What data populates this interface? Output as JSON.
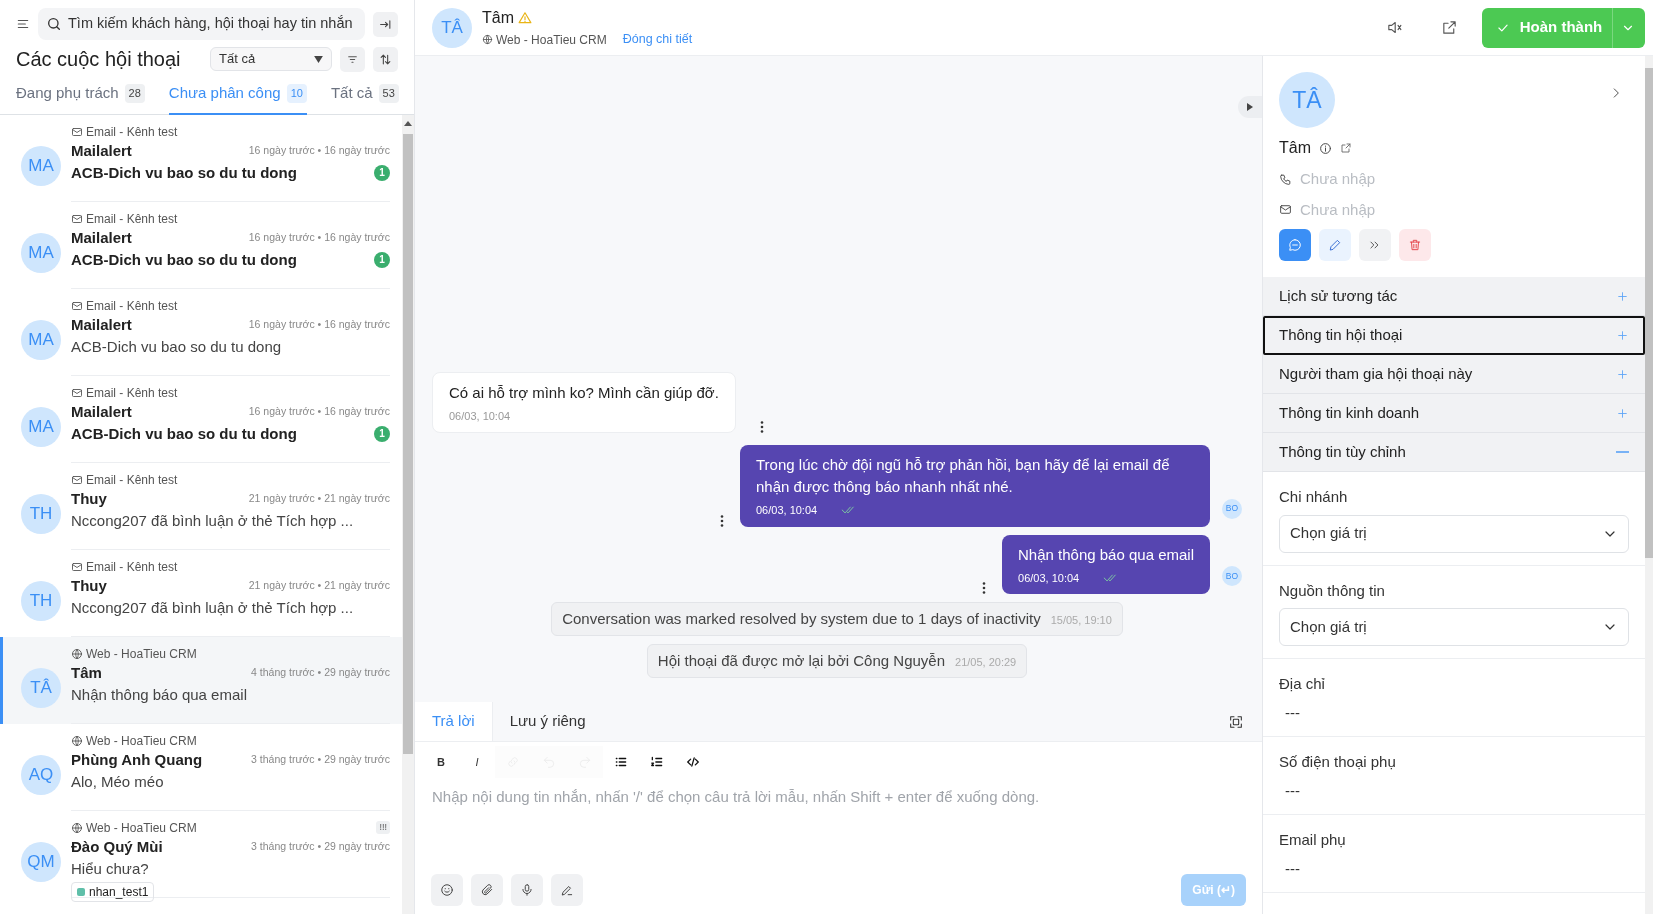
{
  "sidebar": {
    "search": {
      "placeholder": "Tìm kiếm khách hàng, hội thoại hay tin nhắn"
    },
    "title": "Các cuộc hội thoại",
    "filter": {
      "value": "Tất cả"
    },
    "tabs": [
      {
        "label": "Đang phụ trách",
        "count": "28",
        "selected": false
      },
      {
        "label": "Chưa phân công",
        "count": "10",
        "selected": true
      },
      {
        "label": "Tất cả",
        "count": "53",
        "selected": false
      }
    ],
    "conversations": [
      {
        "initials": "MA",
        "kind": "email",
        "channel": "Email - Kênh test",
        "name": "Mailalert",
        "time": "16 ngày trước • 16 ngày trước",
        "preview": "ACB-Dich vu bao so du tu dong",
        "unread": "1",
        "selected": false
      },
      {
        "initials": "MA",
        "kind": "email",
        "channel": "Email - Kênh test",
        "name": "Mailalert",
        "time": "16 ngày trước • 16 ngày trước",
        "preview": "ACB-Dich vu bao so du tu dong",
        "unread": "1",
        "selected": false
      },
      {
        "initials": "MA",
        "kind": "email",
        "channel": "Email - Kênh test",
        "name": "Mailalert",
        "time": "16 ngày trước • 16 ngày trước",
        "preview": "ACB-Dich vu bao so du tu dong",
        "selected": false
      },
      {
        "initials": "MA",
        "kind": "email",
        "channel": "Email - Kênh test",
        "name": "Mailalert",
        "time": "16 ngày trước • 16 ngày trước",
        "preview": "ACB-Dich vu bao so du tu dong",
        "unread": "1",
        "selected": false
      },
      {
        "initials": "TH",
        "kind": "email",
        "channel": "Email - Kênh test",
        "name": "Thuy",
        "time": "21 ngày trước • 21 ngày trước",
        "preview": "Nccong207 đã bình luận ở thẻ Tích hợp ...",
        "selected": false
      },
      {
        "initials": "TH",
        "kind": "email",
        "channel": "Email - Kênh test",
        "name": "Thuy",
        "time": "21 ngày trước • 21 ngày trước",
        "preview": "Nccong207 đã bình luận ở thẻ Tích hợp ...",
        "selected": false
      },
      {
        "initials": "TÂ",
        "kind": "web",
        "channel": "Web - HoaTieu CRM",
        "name": "Tâm",
        "time": "4 tháng trước • 29 ngày trước",
        "preview": "Nhận thông báo qua email",
        "selected": true
      },
      {
        "initials": "AQ",
        "kind": "web",
        "channel": "Web - HoaTieu CRM",
        "name": "Phùng Anh Quang",
        "time": "3 tháng trước • 29 ngày trước",
        "preview": "Alo, Méo méo",
        "selected": false
      },
      {
        "initials": "QM",
        "kind": "web",
        "channel": "Web - HoaTieu CRM",
        "name": "Đào Quý Mùi",
        "time": "3 tháng trước • 29 ngày trước",
        "preview": "Hiểu chưa?",
        "priority": "!!!",
        "tag": {
          "label": "nhan_test1",
          "color": "#5fbfa9"
        },
        "selected": false
      }
    ]
  },
  "conversation": {
    "initials": "TÂ",
    "name": "Tâm",
    "channel": "Web - HoaTieu CRM",
    "detail_link": "Đóng chi tiết",
    "resolve_button": "Hoàn thành"
  },
  "messages": [
    {
      "kind": "incoming",
      "text": "Có ai hỗ trợ mình ko? Mình cần giúp đỡ.",
      "time": "06/03, 10:04"
    },
    {
      "kind": "outgoing",
      "text": "Trong lúc chờ đội ngũ hỗ trợ phản hồi, bạn hãy để lại email để nhận được thông báo nhanh nhất nhé.",
      "time": "06/03, 10:04",
      "avatar": "BO"
    },
    {
      "kind": "outgoing",
      "text": "Nhận thông báo qua email",
      "time": "06/03, 10:04",
      "avatar": "BO"
    },
    {
      "kind": "activity",
      "text": "Conversation was marked resolved by system due to 1 days of inactivity",
      "time": "15/05, 19:10"
    },
    {
      "kind": "activity",
      "text": "Hội thoại đã được mở lại bởi Công Nguyễn",
      "time": "21/05, 20:29"
    }
  ],
  "composer": {
    "tabs": [
      {
        "label": "Trả lời",
        "selected": true
      },
      {
        "label": "Lưu ý riêng",
        "selected": false
      }
    ],
    "toolbar": [
      {
        "kind": "bold",
        "label": "B",
        "disabled": false
      },
      {
        "kind": "italic",
        "label": "I",
        "disabled": false
      },
      {
        "kind": "link",
        "disabled": true
      },
      {
        "kind": "undo",
        "disabled": true
      },
      {
        "kind": "redo",
        "disabled": true
      },
      {
        "kind": "bullet-list",
        "disabled": false
      },
      {
        "kind": "ordered-list",
        "disabled": false
      },
      {
        "kind": "code",
        "disabled": false
      }
    ],
    "placeholder": "Nhập nội dung tin nhắn, nhấn '/' để chọn câu trả lời mẫu, nhấn Shift + enter để xuống dòng.",
    "send_button": {
      "label": "Gửi (↵)",
      "disabled": true
    }
  },
  "contact": {
    "initials": "TÂ",
    "name": "Tâm",
    "phone": {
      "placeholder": "Chưa nhập"
    },
    "email": {
      "placeholder": "Chưa nhập"
    },
    "sections": [
      {
        "title": "Lịch sử tương tác",
        "expanded": false,
        "focused": false
      },
      {
        "title": "Thông tin hội thoại",
        "expanded": false,
        "focused": true
      },
      {
        "title": "Người tham gia hội thoại này",
        "expanded": false,
        "focused": false
      },
      {
        "title": "Thông tin kinh doanh",
        "expanded": false,
        "focused": false
      },
      {
        "title": "Thông tin tùy chỉnh",
        "expanded": true,
        "focused": false
      }
    ],
    "fields": [
      {
        "label": "Chi nhánh",
        "kind": "select",
        "placeholder": "Chọn giá trị"
      },
      {
        "label": "Nguồn thông tin",
        "kind": "select",
        "placeholder": "Chọn giá trị"
      },
      {
        "label": "Địa chỉ",
        "kind": "text",
        "value": "---"
      },
      {
        "label": "Số điện thoại phụ",
        "kind": "text",
        "value": "---"
      },
      {
        "label": "Email phụ",
        "kind": "text",
        "value": "---"
      }
    ]
  }
}
